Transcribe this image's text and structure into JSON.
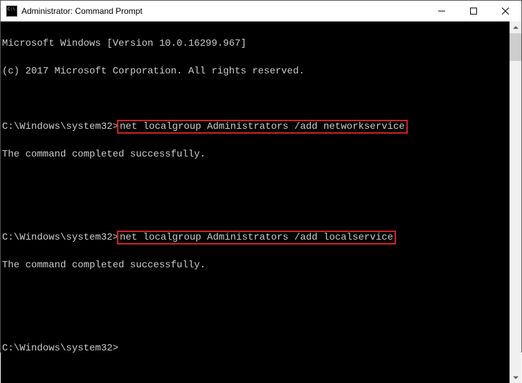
{
  "window": {
    "title": "Administrator: Command Prompt"
  },
  "console": {
    "line_version": "Microsoft Windows [Version 10.0.16299.967]",
    "line_copyright": "(c) 2017 Microsoft Corporation. All rights reserved.",
    "prompt": "C:\\Windows\\system32>",
    "cmd1": "net localgroup Administrators /add networkservice",
    "result1": "The command completed successfully.",
    "cmd2": "net localgroup Administrators /add localservice",
    "result2": "The command completed successfully."
  }
}
